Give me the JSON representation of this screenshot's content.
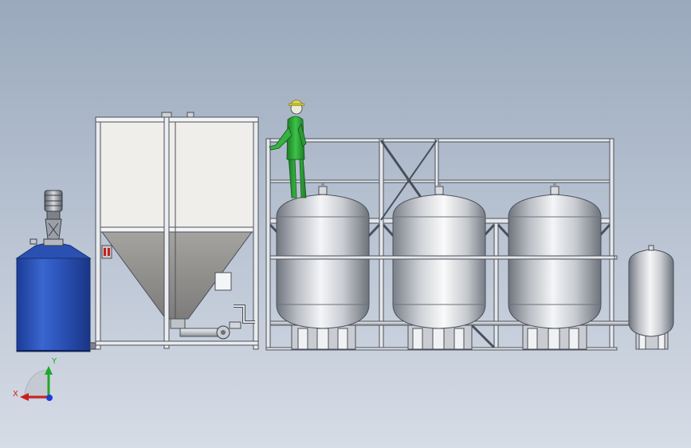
{
  "viewport": {
    "background_top": "#9aa9bd",
    "background_bottom": "#d6dce6"
  },
  "colors": {
    "blue_tank": "#2b53b8",
    "hopper_panel": "#f1efec",
    "hopper_cone": "#8e8d8b",
    "steel_light": "#e6e8ec",
    "steel_dark": "#7f8590",
    "frame_line": "#444a55",
    "worker_green": "#2fa53a",
    "helmet_yellow": "#e0d64a",
    "axis_x": "#cc1f1f",
    "axis_y": "#1fa82b",
    "axis_z": "#1f3bd6"
  },
  "triad": {
    "x_label": "X",
    "y_label": "Y",
    "x_icon": "arrow-left-icon",
    "y_icon": "arrow-up-icon",
    "z_icon": "origin-dot-icon"
  },
  "components": {
    "blue_tank": "blue-storage-tank",
    "hopper": "conical-hopper",
    "vessels": [
      "pressure-vessel-1",
      "pressure-vessel-2",
      "pressure-vessel-3"
    ],
    "small_vessel": "small-pressure-vessel",
    "platform": "access-platform",
    "worker": "operator-figure"
  }
}
